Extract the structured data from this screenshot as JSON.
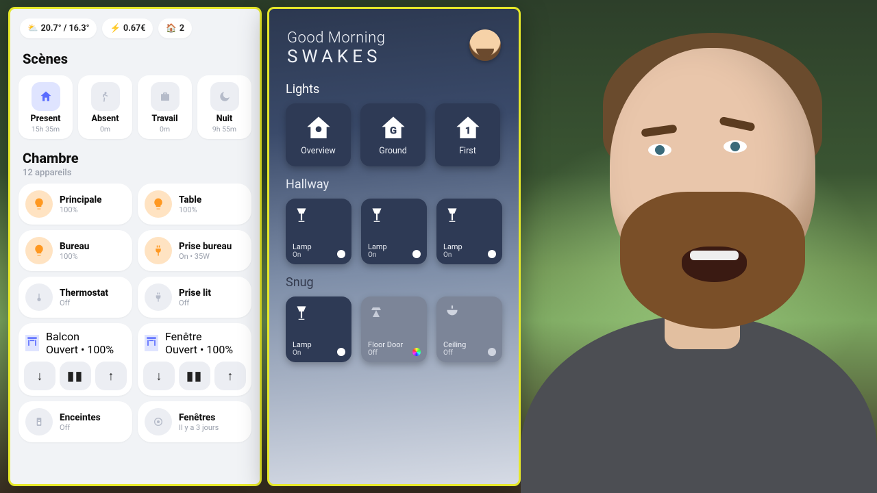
{
  "left": {
    "status": {
      "temp": "20.7° / 16.3°",
      "energy": "0.67€",
      "people": "2"
    },
    "scenes_title": "Scènes",
    "scenes": [
      {
        "label": "Present",
        "sub": "15h 35m",
        "icon": "home",
        "active": true
      },
      {
        "label": "Absent",
        "sub": "0m",
        "icon": "walk",
        "active": false
      },
      {
        "label": "Travail",
        "sub": "0m",
        "icon": "brief",
        "active": false
      },
      {
        "label": "Nuit",
        "sub": "9h 55m",
        "icon": "moon",
        "active": false
      }
    ],
    "room_title": "Chambre",
    "room_sub": "12 appareils",
    "devices": [
      {
        "name": "Principale",
        "sub": "100%",
        "color": "orange",
        "icon": "bulb"
      },
      {
        "name": "Table",
        "sub": "100%",
        "color": "orange",
        "icon": "bulb"
      },
      {
        "name": "Bureau",
        "sub": "100%",
        "color": "orange",
        "icon": "bulb"
      },
      {
        "name": "Prise bureau",
        "sub": "On • 35W",
        "color": "orange",
        "icon": "plug"
      },
      {
        "name": "Thermostat",
        "sub": "Off",
        "color": "grey",
        "icon": "thermo"
      },
      {
        "name": "Prise lit",
        "sub": "Off",
        "color": "grey",
        "icon": "plug"
      }
    ],
    "covers": [
      {
        "name": "Balcon",
        "sub": "Ouvert • 100%"
      },
      {
        "name": "Fenêtre",
        "sub": "Ouvert • 100%"
      }
    ],
    "bottom": [
      {
        "name": "Enceintes",
        "sub": "Off",
        "icon": "speaker"
      },
      {
        "name": "Fenêtres",
        "sub": "Il y a 3 jours",
        "icon": "sensor"
      }
    ]
  },
  "right": {
    "greeting": "Good Morning",
    "name": "SWAKES",
    "sections": {
      "lights": "Lights",
      "hallway": "Hallway",
      "snug": "Snug"
    },
    "nav": [
      {
        "label": "Overview",
        "glyph": "bulb"
      },
      {
        "label": "Ground",
        "glyph": "G"
      },
      {
        "label": "First",
        "glyph": "1"
      }
    ],
    "hallway": [
      {
        "title": "Lamp",
        "state": "On",
        "on": true
      },
      {
        "title": "Lamp",
        "state": "On",
        "on": true
      },
      {
        "title": "Lamp",
        "state": "On",
        "on": true
      }
    ],
    "snug": [
      {
        "title": "Lamp",
        "state": "On",
        "on": true,
        "dot": "white",
        "icon": "lamp"
      },
      {
        "title": "Floor Door",
        "state": "Off",
        "on": false,
        "dot": "rgb",
        "icon": "spot"
      },
      {
        "title": "Ceiling",
        "state": "Off",
        "on": false,
        "dot": "white",
        "icon": "ceiling"
      }
    ]
  }
}
